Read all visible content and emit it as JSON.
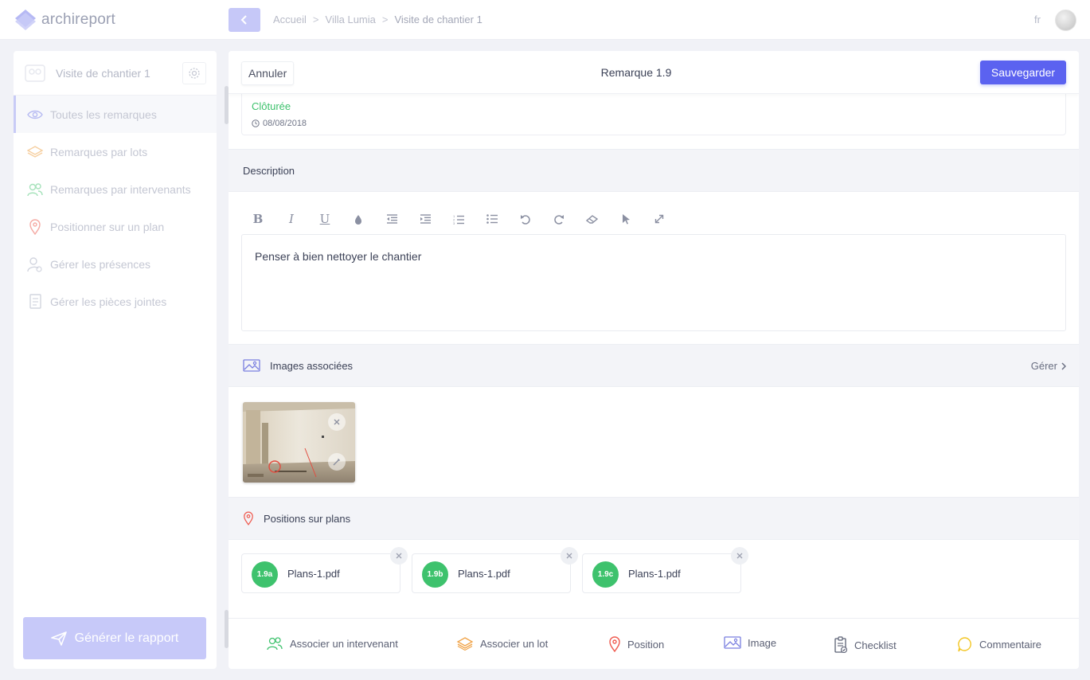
{
  "app": {
    "name": "archireport",
    "language": "fr"
  },
  "breadcrumb": [
    "Accueil",
    "Villa Lumia",
    "Visite de chantier 1"
  ],
  "sidebar": {
    "title": "Visite de chantier 1",
    "items": [
      {
        "label": "Toutes les remarques",
        "icon": "eye-icon"
      },
      {
        "label": "Remarques par lots",
        "icon": "layers-icon"
      },
      {
        "label": "Remarques par intervenants",
        "icon": "users-icon"
      },
      {
        "label": "Positionner sur un plan",
        "icon": "map-pin-icon"
      },
      {
        "label": "Gérer les présences",
        "icon": "user-check-icon"
      },
      {
        "label": "Gérer les pièces jointes",
        "icon": "document-icon"
      }
    ],
    "generate_label": "Générer le rapport"
  },
  "panel": {
    "cancel_label": "Annuler",
    "title": "Remarque 1.9",
    "save_label": "Sauvegarder",
    "status": {
      "label": "Clôturée",
      "date": "08/08/2018"
    },
    "description": {
      "heading": "Description",
      "text": "Penser à bien nettoyer le chantier",
      "toolbar": [
        "B",
        "I",
        "U",
        "color",
        "outdent",
        "indent",
        "ordered-list",
        "bullet-list",
        "undo",
        "redo",
        "eraser",
        "pointer",
        "fullscreen"
      ]
    },
    "images": {
      "heading": "Images associées",
      "manage_label": "Gérer"
    },
    "plans": {
      "heading": "Positions sur plans",
      "items": [
        {
          "badge": "1.9a",
          "name": "Plans-1.pdf"
        },
        {
          "badge": "1.9b",
          "name": "Plans-1.pdf"
        },
        {
          "badge": "1.9c",
          "name": "Plans-1.pdf"
        }
      ]
    },
    "actions": [
      {
        "label": "Associer un intervenant",
        "icon": "users-icon"
      },
      {
        "label": "Associer un lot",
        "icon": "layers-icon"
      },
      {
        "label": "Position",
        "icon": "map-pin-icon"
      },
      {
        "label": "Image",
        "icon": "image-icon"
      },
      {
        "label": "Checklist",
        "icon": "checklist-icon"
      },
      {
        "label": "Commentaire",
        "icon": "comment-icon"
      }
    ]
  },
  "colors": {
    "primary": "#5b62f0",
    "primary_light": "#c7c9f9",
    "success": "#3ec26d",
    "orange": "#f0a347",
    "red": "#ef5b50",
    "yellow": "#f3c623"
  }
}
